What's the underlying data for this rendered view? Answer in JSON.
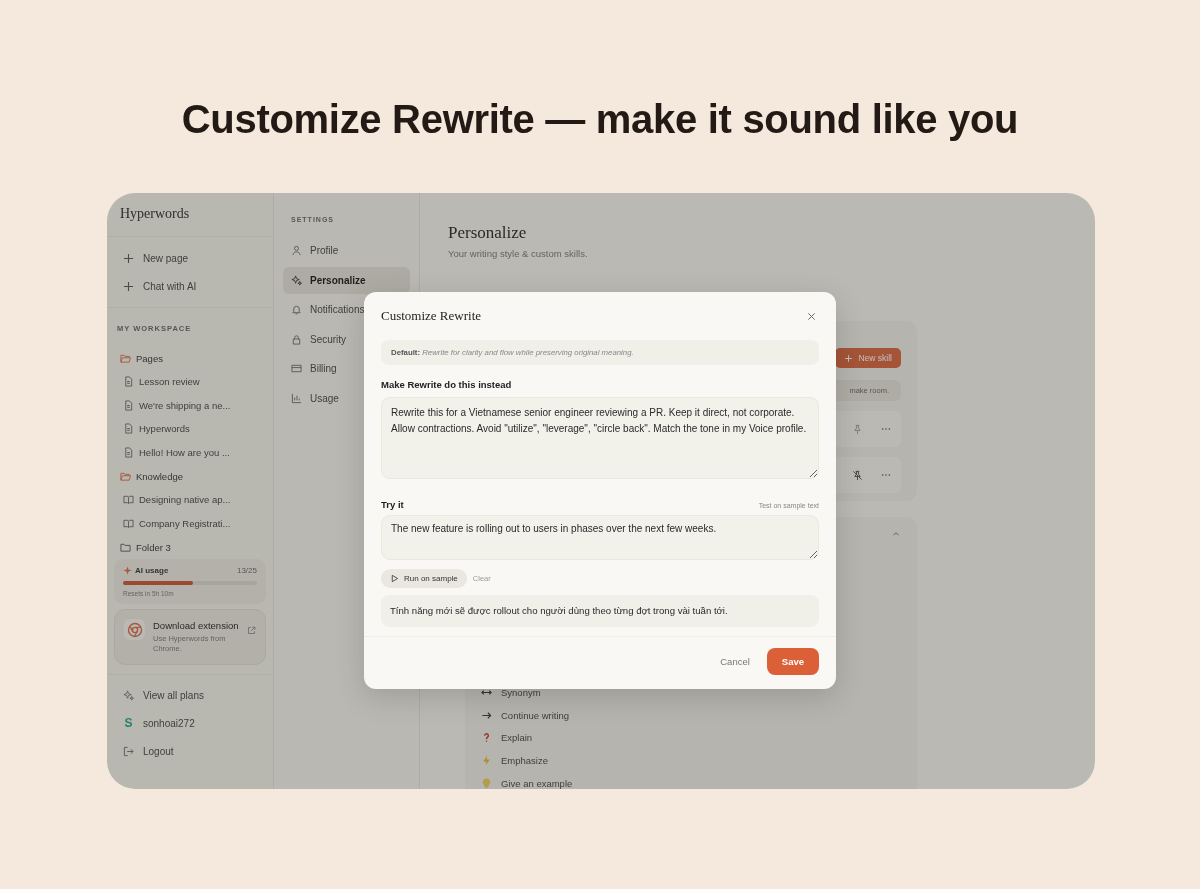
{
  "headline": "Customize Rewrite — make it sound like you",
  "sidebar": {
    "brand": "Hyperwords",
    "actions": [
      {
        "label": "New page"
      },
      {
        "label": "Chat with AI"
      }
    ],
    "section_label": "MY WORKSPACE",
    "tree": [
      {
        "label": "Pages",
        "expanded": true,
        "children": [
          {
            "label": "Lesson review",
            "kind": "page"
          },
          {
            "label": "We're shipping a ne...",
            "kind": "page"
          },
          {
            "label": "Hyperwords",
            "kind": "page"
          },
          {
            "label": "Hello! How are you ...",
            "kind": "page"
          }
        ]
      },
      {
        "label": "Knowledge",
        "expanded": true,
        "children": [
          {
            "label": "Designing native ap...",
            "kind": "book"
          },
          {
            "label": "Company Registrati...",
            "kind": "book"
          }
        ]
      },
      {
        "label": "Folder 3",
        "expanded": false
      }
    ],
    "usage": {
      "label": "AI usage",
      "count": "13/25",
      "level": 0.52,
      "note": "Resets in 5h 10m"
    },
    "extension": {
      "title": "Download extension",
      "description": "Use Hyperwords from Chrome."
    },
    "footer": [
      {
        "label": "View all plans",
        "kind": "plans"
      },
      {
        "label": "sonhoai272",
        "kind": "user",
        "avatar": "S"
      },
      {
        "label": "Logout",
        "kind": "logout"
      }
    ]
  },
  "settings_nav": {
    "heading": "SETTINGS",
    "items": [
      {
        "label": "Profile",
        "selected": false
      },
      {
        "label": "Personalize",
        "selected": true
      },
      {
        "label": "Notifications",
        "selected": false
      },
      {
        "label": "Security",
        "selected": false
      },
      {
        "label": "Billing",
        "selected": false
      },
      {
        "label": "Usage",
        "selected": false
      }
    ]
  },
  "main": {
    "title": "Personalize",
    "subtitle": "Your writing style & custom skills.",
    "new_skill_button": "New skill",
    "note": "make room.",
    "skill_rows": [
      {
        "pinned": false
      },
      {
        "pinned": true
      }
    ],
    "builtin": {
      "expanded": true,
      "items": [
        {
          "label": "Synonym",
          "kind": "swap"
        },
        {
          "label": "Continue writing",
          "kind": "arrow"
        },
        {
          "label": "Explain",
          "kind": "question"
        },
        {
          "label": "Emphasize",
          "kind": "bolt"
        },
        {
          "label": "Give an example",
          "kind": "bulb"
        }
      ]
    }
  },
  "modal": {
    "title": "Customize Rewrite",
    "default_text": "**Default:** *Rewrite for clarity and flow while preserving original meaning.*",
    "instruction_label": "Make Rewrite do this instead",
    "instruction_value": "Rewrite this for a Vietnamese senior engineer reviewing a PR. Keep it direct, not corporate. Allow contractions. Avoid \"utilize\", \"leverage\", \"circle back\". Match the tone in my Voice profile.",
    "try_label": "Try it",
    "try_hint": "Test on sample text",
    "sample_value": "The new feature is rolling out to users in phases over the next few weeks.",
    "run_button": "Run on sample",
    "clear_button": "Clear",
    "result": "Tính năng mới sẽ được rollout cho người dùng theo từng đợt trong vài tuần tới.",
    "cancel_button": "Cancel",
    "save_button": "Save"
  }
}
